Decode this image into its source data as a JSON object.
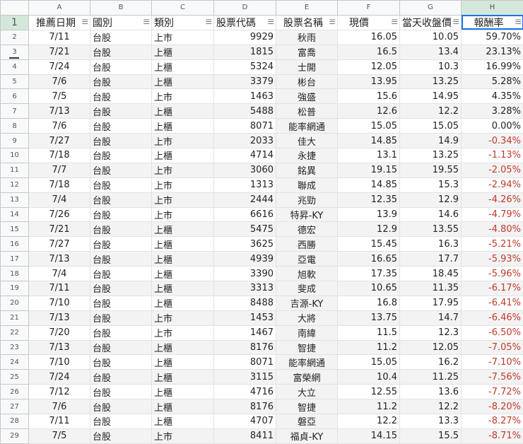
{
  "columns": [
    "A",
    "B",
    "C",
    "D",
    "E",
    "F",
    "G",
    "H"
  ],
  "headers": [
    "推薦日期",
    "國別",
    "類別",
    "股票代碼",
    "股票名稱",
    "現價",
    "當天收盤價",
    "報酬率"
  ],
  "rows": [
    [
      "7/11",
      "台股",
      "上市",
      "9929",
      "秋雨",
      "16.05",
      "10.05",
      "59.70%"
    ],
    [
      "7/21",
      "台股",
      "上櫃",
      "1815",
      "富喬",
      "16.5",
      "13.4",
      "23.13%"
    ],
    [
      "7/24",
      "台股",
      "上櫃",
      "5324",
      "士開",
      "12.05",
      "10.3",
      "16.99%"
    ],
    [
      "7/6",
      "台股",
      "上櫃",
      "3379",
      "彬台",
      "13.95",
      "13.25",
      "5.28%"
    ],
    [
      "7/5",
      "台股",
      "上市",
      "1463",
      "強盛",
      "15.6",
      "14.95",
      "4.35%"
    ],
    [
      "7/13",
      "台股",
      "上櫃",
      "5488",
      "松普",
      "12.6",
      "12.2",
      "3.28%"
    ],
    [
      "7/6",
      "台股",
      "上櫃",
      "8071",
      "能率網通",
      "15.05",
      "15.05",
      "0.00%"
    ],
    [
      "7/27",
      "台股",
      "上市",
      "2033",
      "佳大",
      "14.85",
      "14.9",
      "-0.34%"
    ],
    [
      "7/18",
      "台股",
      "上櫃",
      "4714",
      "永捷",
      "13.1",
      "13.25",
      "-1.13%"
    ],
    [
      "7/7",
      "台股",
      "上市",
      "3060",
      "銘異",
      "19.15",
      "19.55",
      "-2.05%"
    ],
    [
      "7/18",
      "台股",
      "上市",
      "1313",
      "聯成",
      "14.85",
      "15.3",
      "-2.94%"
    ],
    [
      "7/4",
      "台股",
      "上市",
      "2444",
      "兆勁",
      "12.35",
      "12.9",
      "-4.26%"
    ],
    [
      "7/26",
      "台股",
      "上市",
      "6616",
      "特昇-KY",
      "13.9",
      "14.6",
      "-4.79%"
    ],
    [
      "7/21",
      "台股",
      "上櫃",
      "5475",
      "德宏",
      "12.9",
      "13.55",
      "-4.80%"
    ],
    [
      "7/27",
      "台股",
      "上櫃",
      "3625",
      "西勝",
      "15.45",
      "16.3",
      "-5.21%"
    ],
    [
      "7/13",
      "台股",
      "上櫃",
      "4939",
      "亞電",
      "16.65",
      "17.7",
      "-5.93%"
    ],
    [
      "7/4",
      "台股",
      "上櫃",
      "3390",
      "旭軟",
      "17.35",
      "18.45",
      "-5.96%"
    ],
    [
      "7/11",
      "台股",
      "上櫃",
      "3313",
      "斐成",
      "10.65",
      "11.35",
      "-6.17%"
    ],
    [
      "7/10",
      "台股",
      "上櫃",
      "8488",
      "吉源-KY",
      "16.8",
      "17.95",
      "-6.41%"
    ],
    [
      "7/13",
      "台股",
      "上市",
      "1453",
      "大將",
      "13.75",
      "14.7",
      "-6.46%"
    ],
    [
      "7/20",
      "台股",
      "上市",
      "1467",
      "南緯",
      "11.5",
      "12.3",
      "-6.50%"
    ],
    [
      "7/13",
      "台股",
      "上櫃",
      "8176",
      "智捷",
      "11.2",
      "12.05",
      "-7.05%"
    ],
    [
      "7/10",
      "台股",
      "上櫃",
      "8071",
      "能率網通",
      "15.05",
      "16.2",
      "-7.10%"
    ],
    [
      "7/24",
      "台股",
      "上櫃",
      "3115",
      "富榮網",
      "10.4",
      "11.25",
      "-7.56%"
    ],
    [
      "7/12",
      "台股",
      "上櫃",
      "4716",
      "大立",
      "12.55",
      "13.6",
      "-7.72%"
    ],
    [
      "7/6",
      "台股",
      "上櫃",
      "8176",
      "智捷",
      "11.2",
      "12.2",
      "-8.20%"
    ],
    [
      "7/11",
      "台股",
      "上櫃",
      "4707",
      "磐亞",
      "12.2",
      "13.3",
      "-8.27%"
    ],
    [
      "7/5",
      "台股",
      "上市",
      "8411",
      "福貞-KY",
      "14.15",
      "15.5",
      "-8.71%"
    ]
  ],
  "negative_color": "#c0392b",
  "active_cell": "H1"
}
